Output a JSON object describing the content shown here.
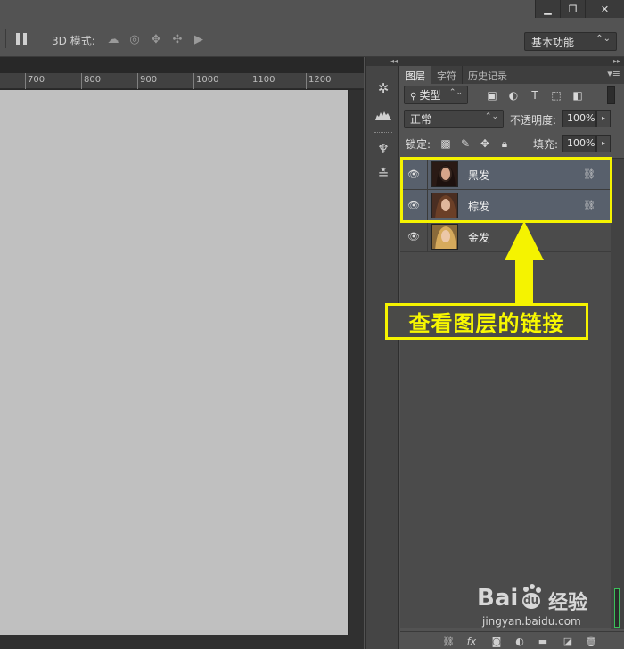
{
  "window": {
    "minimize_glyph": "▁",
    "restore_glyph": "❐",
    "close_glyph": "✕"
  },
  "options_bar": {
    "mode_label": "3D 模式:",
    "workspace": "基本功能",
    "icons": [
      "orbit-icon",
      "roll-icon",
      "pan-icon",
      "slide-icon",
      "camera-icon"
    ]
  },
  "ruler": {
    "labels": [
      "700",
      "800",
      "900",
      "1000",
      "1100",
      "1200"
    ]
  },
  "panel": {
    "tabs": [
      "图层",
      "字符",
      "历史记录"
    ],
    "filter_kind": "类型",
    "blend_mode": "正常",
    "opacity_label": "不透明度:",
    "opacity_value": "100%",
    "lock_label": "锁定:",
    "fill_label": "填充:",
    "fill_value": "100%",
    "layers": [
      {
        "name": "黑发",
        "selected": true,
        "linked": true
      },
      {
        "name": "棕发",
        "selected": true,
        "linked": true
      },
      {
        "name": "金发",
        "selected": false,
        "linked": false
      }
    ],
    "bottom_icons": [
      "link-layers-icon",
      "fx-icon",
      "mask-icon",
      "adjustment-icon",
      "group-folder-icon",
      "new-layer-icon",
      "trash-icon"
    ]
  },
  "annotation": {
    "callout": "查看图层的链接",
    "color": "#f5f300"
  },
  "watermark": {
    "brand": "Bai",
    "paw": "du",
    "cn": "经验",
    "url": "jingyan.baidu.com"
  }
}
